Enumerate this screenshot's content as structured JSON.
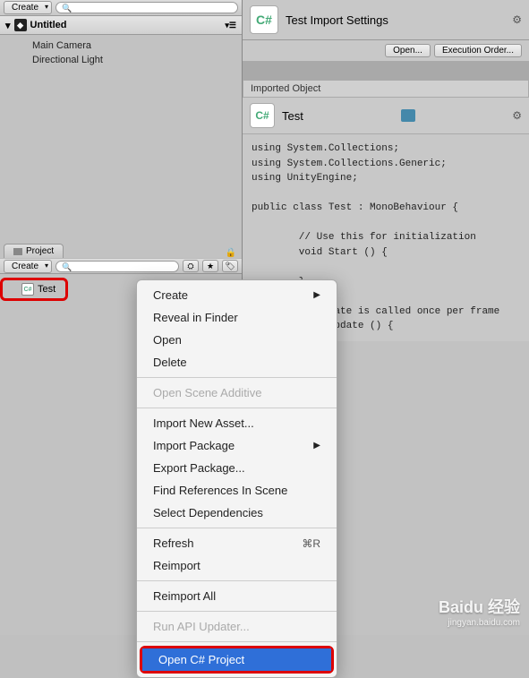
{
  "toolbar_top": {
    "create": "Create"
  },
  "hierarchy": {
    "title": "Untitled",
    "items": [
      "Main Camera",
      "Directional Light"
    ]
  },
  "project": {
    "tab": "Project",
    "create": "Create",
    "asset": "Test"
  },
  "inspector": {
    "title": "Test Import Settings",
    "open": "Open...",
    "exec_order": "Execution Order...",
    "imported": "Imported Object",
    "script_name": "Test"
  },
  "code": "using System.Collections;\nusing System.Collections.Generic;\nusing UnityEngine;\n\npublic class Test : MonoBehaviour {\n\n        // Use this for initialization\n        void Start () {\n\n        }\n\n        // Update is called once per frame\n        void Update () {\n",
  "menu": {
    "create": "Create",
    "reveal": "Reveal in Finder",
    "open": "Open",
    "delete": "Delete",
    "open_scene": "Open Scene Additive",
    "import_asset": "Import New Asset...",
    "import_package": "Import Package",
    "export_package": "Export Package...",
    "find_refs": "Find References In Scene",
    "select_deps": "Select Dependencies",
    "refresh": "Refresh",
    "refresh_key": "⌘R",
    "reimport": "Reimport",
    "reimport_all": "Reimport All",
    "run_api": "Run API Updater...",
    "open_cs": "Open C# Project"
  },
  "watermark": {
    "brand": "Baidu 经验",
    "sub": "jingyan.baidu.com"
  }
}
